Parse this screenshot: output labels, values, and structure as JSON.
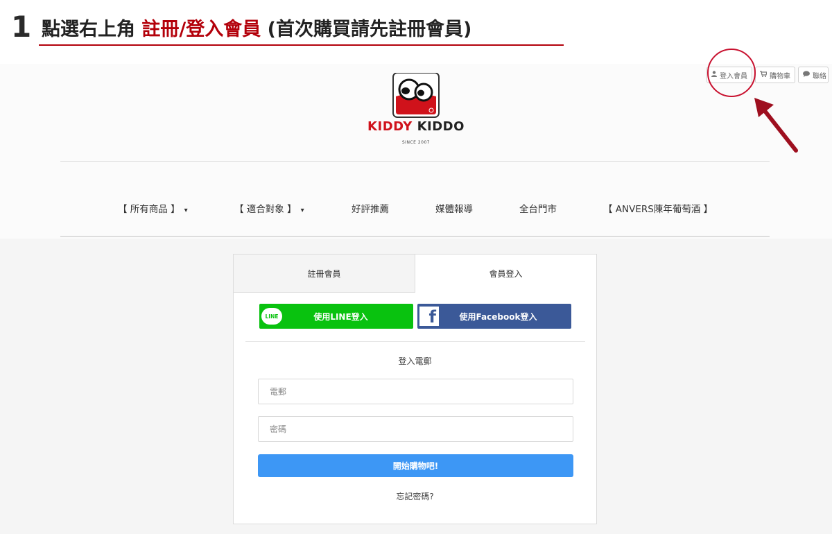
{
  "step": {
    "number": "1",
    "prefix": "點選右上角 ",
    "highlight": "註冊/登入會員",
    "suffix": " (首次購買請先註冊會員)",
    "accent_color": "#b3000a"
  },
  "header": {
    "top_links": [
      {
        "icon": "user-icon",
        "icon_glyph": "●",
        "label": "登入會員"
      },
      {
        "icon": "cart-icon",
        "icon_glyph": "⛟",
        "label": "購物車"
      },
      {
        "icon": "chat-icon",
        "icon_glyph": "●",
        "label": "聯絡"
      }
    ],
    "logo": {
      "brand_left": "KIDDY",
      "brand_right": "KIDDO",
      "since": "SINCE 2007",
      "brand_color": "#d0121b"
    },
    "nav": [
      {
        "label": "【 所有商品 】",
        "has_dropdown": true
      },
      {
        "label": "【 適合對象 】",
        "has_dropdown": true
      },
      {
        "label": "好評推薦",
        "has_dropdown": false
      },
      {
        "label": "媒體報導",
        "has_dropdown": false
      },
      {
        "label": "全台門市",
        "has_dropdown": false
      },
      {
        "label": "【 ANVERS陳年葡萄酒 】",
        "has_dropdown": false
      }
    ],
    "caret": "▾"
  },
  "login_panel": {
    "tabs": [
      {
        "label": "註冊會員",
        "active": false
      },
      {
        "label": "會員登入",
        "active": true
      }
    ],
    "line_button": {
      "icon_text": "LINE",
      "label": "使用LINE登入",
      "color": "#09c20f"
    },
    "facebook_button": {
      "icon_text": "f",
      "label": "使用Facebook登入",
      "color": "#3b5998"
    },
    "section_label": "登入電郵",
    "email": {
      "value": "",
      "placeholder": "電郵"
    },
    "password": {
      "value": "",
      "placeholder": "密碼"
    },
    "submit_label": "開始購物吧!",
    "submit_color": "#3d97f5",
    "forgot_label": "忘記密碼?"
  }
}
